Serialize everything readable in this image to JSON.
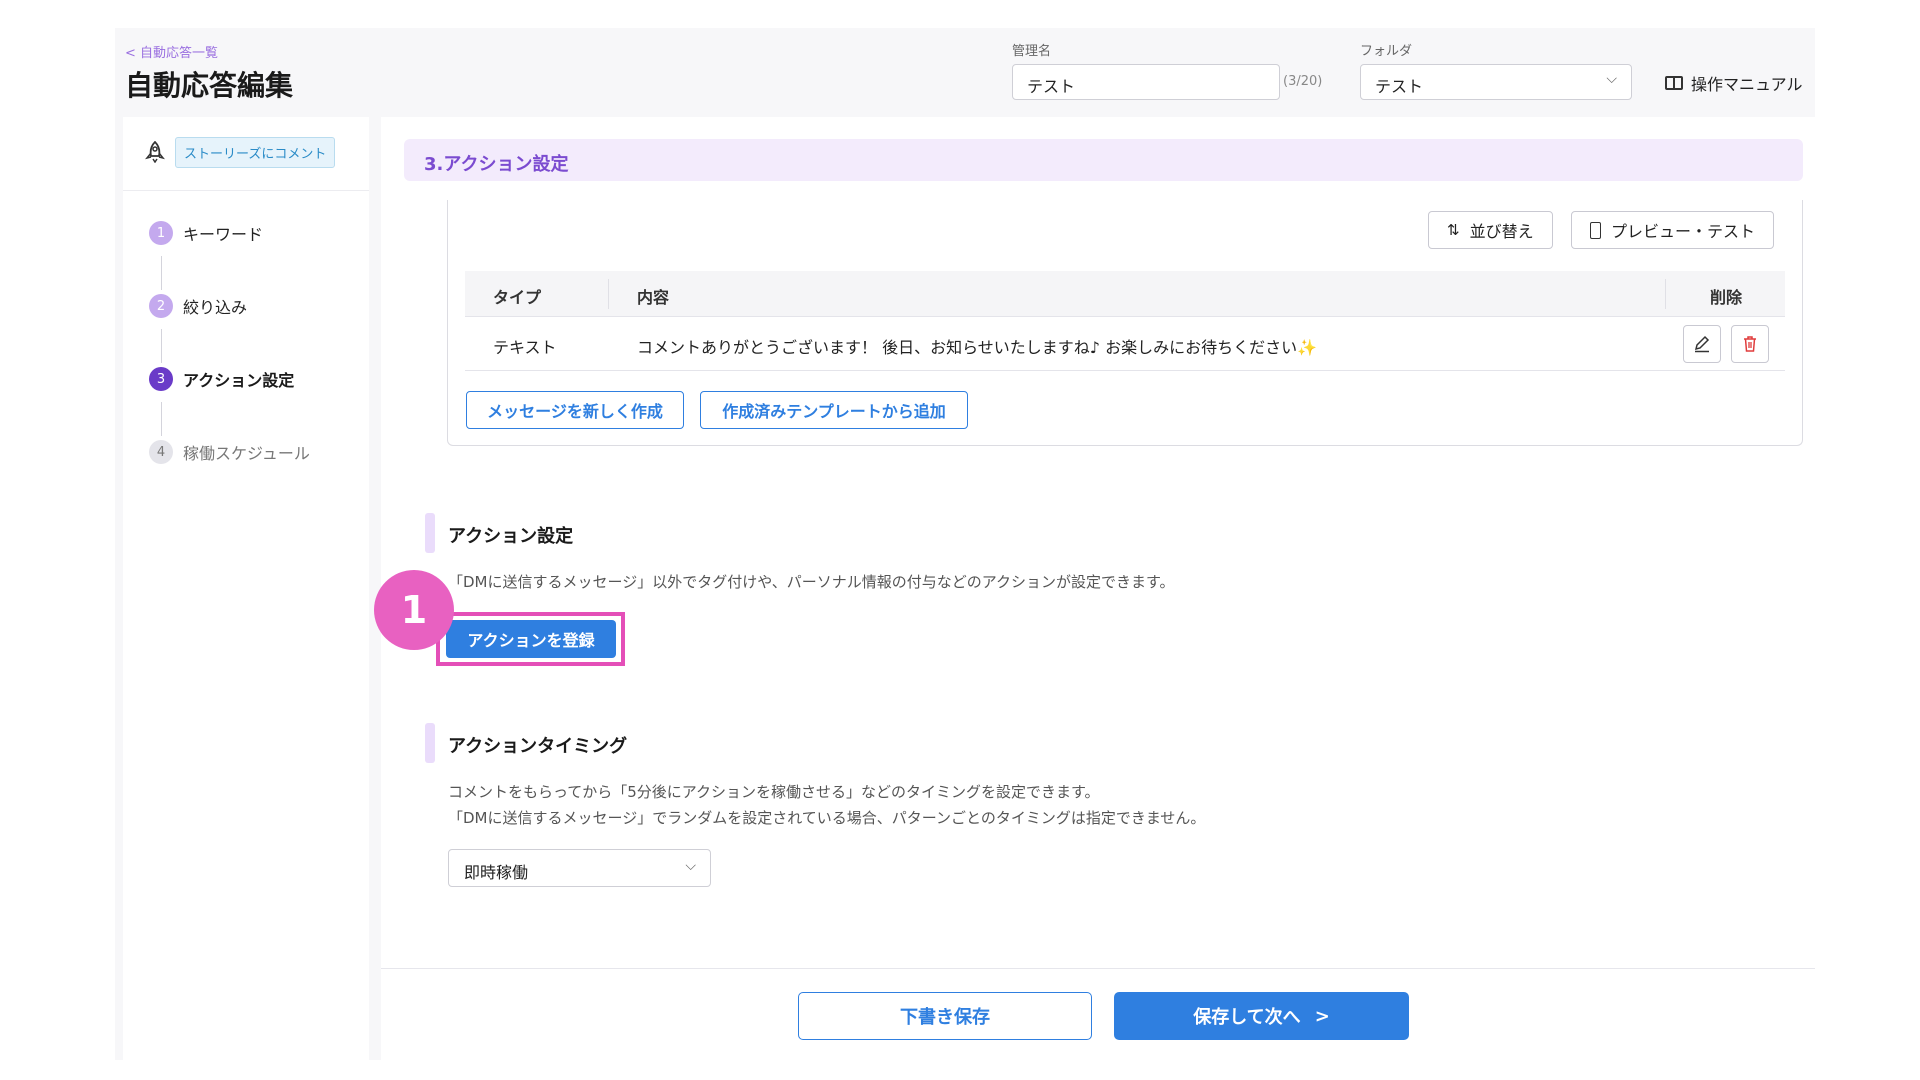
{
  "header": {
    "back_link": "< 自動応答一覧",
    "title": "自動応答編集",
    "name_label": "管理名",
    "name_value": "テスト",
    "name_counter": "(3/20)",
    "folder_label": "フォルダ",
    "folder_value": "テスト",
    "manual_label": "操作マニュアル"
  },
  "sidebar": {
    "trigger_label": "ストーリーズにコメント",
    "steps": [
      {
        "num": "1",
        "label": "キーワード"
      },
      {
        "num": "2",
        "label": "絞り込み"
      },
      {
        "num": "3",
        "label": "アクション設定"
      },
      {
        "num": "4",
        "label": "稼働スケジュール"
      }
    ],
    "active_step": 3
  },
  "main": {
    "section_title": "3.アクション設定",
    "sort_button": "並び替え",
    "preview_button": "プレビュー・テスト",
    "table": {
      "headers": [
        "タイプ",
        "内容",
        "削除"
      ],
      "rows": [
        {
          "type": "テキスト",
          "content": "コメントありがとうございます！ 後日、お知らせいたしますね♪ お楽しみにお待ちください",
          "emoji": "✨"
        }
      ]
    },
    "new_message_button": "メッセージを新しく作成",
    "template_button": "作成済みテンプレートから追加",
    "action": {
      "title": "アクション設定",
      "description": "「DMに送信するメッセージ」以外でタグ付けや、パーソナル情報の付与などのアクションが設定できます。",
      "register_button": "アクションを登録",
      "marker": "1"
    },
    "timing": {
      "title": "アクションタイミング",
      "description_1": "コメントをもらってから「5分後にアクションを稼働させる」などのタイミングを設定できます。",
      "description_2": "「DMに送信するメッセージ」でランダムを設定されている場合、パターンごとのタイミングは指定できません。",
      "selected": "即時稼働"
    }
  },
  "footer": {
    "draft_button": "下書き保存",
    "next_button": "保存して次へ",
    "next_arrow": ">"
  },
  "colors": {
    "accent": "#2f7fe0",
    "purple": "#7b4bd0",
    "highlight": "#e44fb8"
  }
}
